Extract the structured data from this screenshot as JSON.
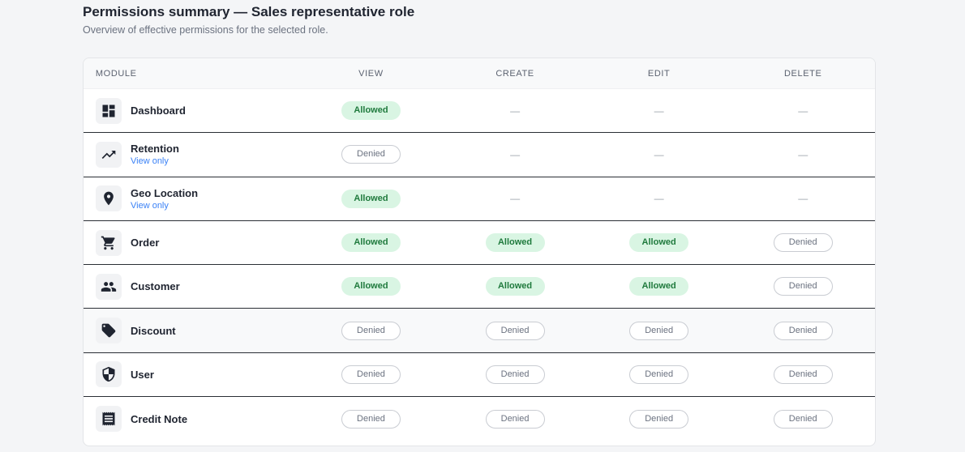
{
  "header": {
    "title": "Permissions summary — Sales representative role",
    "subtitle": "Overview of effective permissions for the selected role."
  },
  "table": {
    "columns": [
      "MODULE",
      "VIEW",
      "CREATE",
      "EDIT",
      "DELETE"
    ],
    "rows": [
      {
        "name": "Dashboard",
        "note": "",
        "icon": "dashboard-icon",
        "view": "Allowed",
        "create": "—",
        "edit": "—",
        "delete": "—"
      },
      {
        "name": "Retention",
        "note": "View only",
        "icon": "trending-up-icon",
        "view": "Denied",
        "create": "—",
        "edit": "—",
        "delete": "—"
      },
      {
        "name": "Geo Location",
        "note": "View only",
        "icon": "location-pin-icon",
        "view": "Allowed",
        "create": "—",
        "edit": "—",
        "delete": "—"
      },
      {
        "name": "Order",
        "note": "",
        "icon": "cart-icon",
        "view": "Allowed",
        "create": "Allowed",
        "edit": "Allowed",
        "delete": "Denied"
      },
      {
        "name": "Customer",
        "note": "",
        "icon": "people-icon",
        "view": "Allowed",
        "create": "Allowed",
        "edit": "Allowed",
        "delete": "Denied"
      },
      {
        "name": "Discount",
        "note": "",
        "icon": "tag-icon",
        "view": "Denied",
        "create": "Denied",
        "edit": "Denied",
        "delete": "Denied"
      },
      {
        "name": "User",
        "note": "",
        "icon": "shield-icon",
        "view": "Denied",
        "create": "Denied",
        "edit": "Denied",
        "delete": "Denied"
      },
      {
        "name": "Credit Note",
        "note": "",
        "icon": "receipt-icon",
        "view": "Denied",
        "create": "Denied",
        "edit": "Denied",
        "delete": "Denied"
      }
    ]
  },
  "colors": {
    "allowed_bg": "#d9f5e3",
    "allowed_text": "#1f7a3d",
    "denied_border": "#c9ccd2",
    "note_link": "#3b82f6"
  }
}
